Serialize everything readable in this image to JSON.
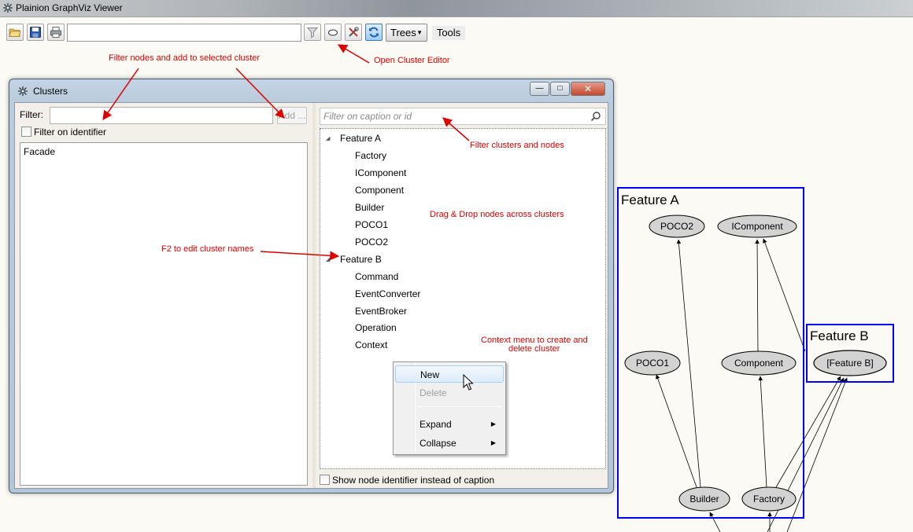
{
  "window": {
    "title": "Plainion GraphViz Viewer"
  },
  "toolbar": {
    "search_value": "",
    "trees_label": "Trees",
    "tools_label": "Tools"
  },
  "clusters_window": {
    "title": "Clusters",
    "filter_label": "Filter:",
    "filter_value": "",
    "add_label": "Add ...",
    "filter_on_identifier_label": "Filter on identifier",
    "left_list": [
      "Facade"
    ],
    "tree_filter_placeholder": "Filter on caption or id",
    "tree": [
      {
        "label": "Feature A",
        "children": [
          "Factory",
          "IComponent",
          "Component",
          "Builder",
          "POCO1",
          "POCO2"
        ]
      },
      {
        "label": "Feature B",
        "children": [
          "Command",
          "EventConverter",
          "EventBroker",
          "Operation",
          "Context"
        ]
      }
    ],
    "show_identifier_label": "Show node identifier instead of caption",
    "context_menu": [
      {
        "label": "New",
        "state": "highlighted"
      },
      {
        "label": "Delete",
        "state": "disabled"
      },
      {
        "label": "Expand",
        "submenu": true
      },
      {
        "label": "Collapse",
        "submenu": true
      }
    ]
  },
  "annotations": {
    "filter_nodes": "Filter nodes and add to selected cluster",
    "open_cluster_editor": "Open Cluster Editor",
    "filter_clusters": "Filter clusters and nodes",
    "drag_drop": "Drag & Drop nodes across clusters",
    "f2_edit": "F2 to edit cluster names",
    "context_menu_line1": "Context menu to create and",
    "context_menu_line2": "delete cluster"
  },
  "graph": {
    "clusters": [
      {
        "label": "Feature A",
        "color": "#0000ff"
      },
      {
        "label": "Feature B",
        "color": "#0000ff"
      }
    ],
    "nodes": [
      "POCO2",
      "IComponent",
      "POCO1",
      "Component",
      "[Feature B]",
      "Builder",
      "Factory"
    ]
  },
  "colors": {
    "annotation": "#e00000",
    "cluster_border": "#0000ff",
    "node_fill": "#d3d3d3"
  }
}
